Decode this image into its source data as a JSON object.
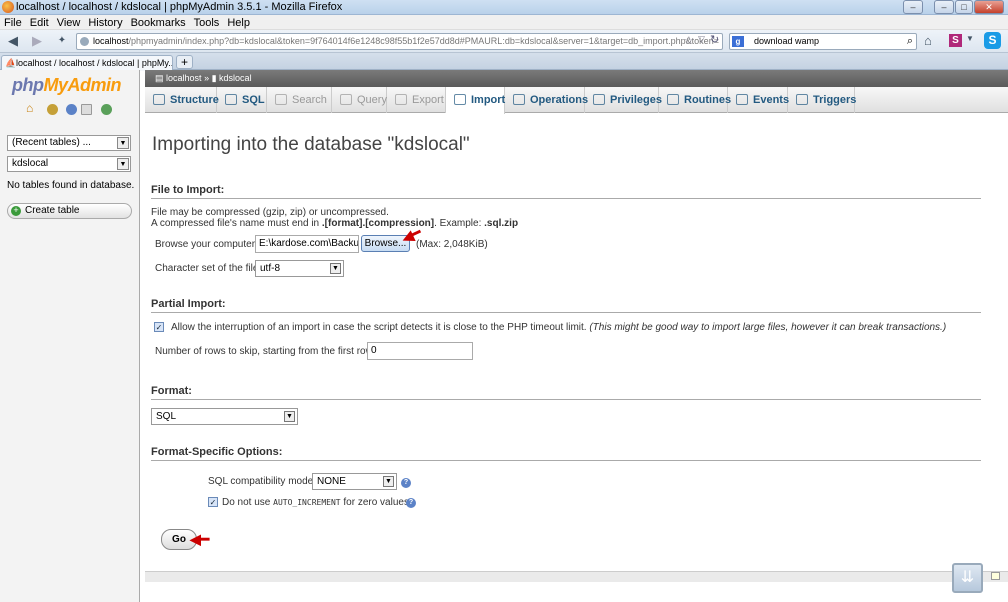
{
  "window": {
    "title": "localhost / localhost / kdslocal | phpMyAdmin 3.5.1 - Mozilla Firefox",
    "min": "–",
    "max": "□",
    "close": "✕"
  },
  "menu": [
    "File",
    "Edit",
    "View",
    "History",
    "Bookmarks",
    "Tools",
    "Help"
  ],
  "nav": {
    "url_host": "localhost",
    "url_rest": "/phpmyadmin/index.php?db=kdslocal&token=9f764014f6e1248c98f55b1f2e57dd8d#PMAURL:db=kdslocal&server=1&target=db_import.php&token=",
    "search_value": "download wamp"
  },
  "browser_tab": {
    "label": "localhost / localhost / kdslocal | phpMy...",
    "new": "+"
  },
  "sidebar": {
    "logo_php": "php",
    "logo_my": "MyAdmin",
    "recent_tables": "(Recent tables) ...",
    "db_select": "kdslocal",
    "no_tables": "No tables found in database.",
    "create_table": "Create table"
  },
  "breadcrumb": {
    "server": "localhost",
    "sep": "»",
    "db": "kdslocal"
  },
  "tabs": [
    {
      "label": "Structure",
      "state": "normal"
    },
    {
      "label": "SQL",
      "state": "normal"
    },
    {
      "label": "Search",
      "state": "disabled"
    },
    {
      "label": "Query",
      "state": "disabled"
    },
    {
      "label": "Export",
      "state": "disabled"
    },
    {
      "label": "Import",
      "state": "active"
    },
    {
      "label": "Operations",
      "state": "normal"
    },
    {
      "label": "Privileges",
      "state": "normal"
    },
    {
      "label": "Routines",
      "state": "normal"
    },
    {
      "label": "Events",
      "state": "normal"
    },
    {
      "label": "Triggers",
      "state": "normal"
    }
  ],
  "page": {
    "heading": "Importing into the database \"kdslocal\"",
    "file_section": "File to Import:",
    "compress_line1": "File may be compressed (gzip, zip) or uncompressed.",
    "compress_line2a": "A compressed file's name must end in ",
    "compress_line2b": ".[format].[compression]",
    "compress_line2c": ". Example: ",
    "compress_line2d": ".sql.zip",
    "browse_label": "Browse your computer:",
    "file_value": "E:\\kardose.com\\Backup",
    "browse_button": "Browse...",
    "max_size": "(Max: 2,048KiB)",
    "charset_label": "Character set of the file:",
    "charset_value": "utf-8",
    "partial_section": "Partial Import:",
    "allow_interrupt": "Allow the interruption of an import in case the script detects it is close to the PHP timeout limit.",
    "allow_interrupt_note": "(This might be good way to import large files, however it can break transactions.)",
    "skip_label": "Number of rows to skip, starting from the first row:",
    "skip_value": "0",
    "format_section": "Format:",
    "format_value": "SQL",
    "options_section": "Format-Specific Options:",
    "compat_label": "SQL compatibility mode:",
    "compat_value": "NONE",
    "no_auto_a": "Do not use ",
    "no_auto_code": "AUTO_INCREMENT",
    "no_auto_b": " for zero values",
    "go": "Go"
  }
}
